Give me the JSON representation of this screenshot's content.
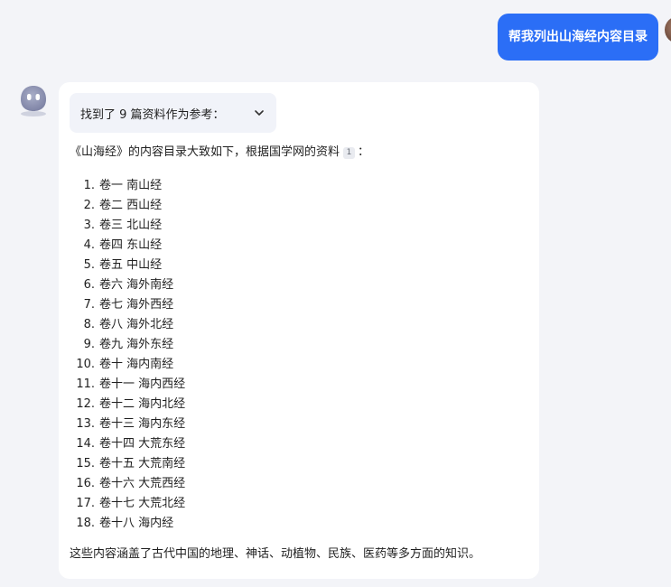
{
  "user_message": {
    "text": "帮我列出山海经内容目录"
  },
  "assistant": {
    "sources_label": "找到了 9 篇资料作为参考：",
    "intro_before": "《山海经》的内容目录大致如下，根据国学网的资料",
    "citation": "1",
    "intro_after": "：",
    "toc": [
      {
        "num": "1.",
        "label": "卷一 南山经"
      },
      {
        "num": "2.",
        "label": "卷二 西山经"
      },
      {
        "num": "3.",
        "label": "卷三 北山经"
      },
      {
        "num": "4.",
        "label": "卷四 东山经"
      },
      {
        "num": "5.",
        "label": "卷五 中山经"
      },
      {
        "num": "6.",
        "label": "卷六 海外南经"
      },
      {
        "num": "7.",
        "label": "卷七 海外西经"
      },
      {
        "num": "8.",
        "label": "卷八 海外北经"
      },
      {
        "num": "9.",
        "label": "卷九 海外东经"
      },
      {
        "num": "10.",
        "label": "卷十 海内南经"
      },
      {
        "num": "11.",
        "label": "卷十一 海内西经"
      },
      {
        "num": "12.",
        "label": "卷十二 海内北经"
      },
      {
        "num": "13.",
        "label": "卷十三 海内东经"
      },
      {
        "num": "14.",
        "label": "卷十四 大荒东经"
      },
      {
        "num": "15.",
        "label": "卷十五 大荒南经"
      },
      {
        "num": "16.",
        "label": "卷十六 大荒西经"
      },
      {
        "num": "17.",
        "label": "卷十七 大荒北经"
      },
      {
        "num": "18.",
        "label": "卷十八 海内经"
      }
    ],
    "summary": "这些内容涵盖了古代中国的地理、神话、动植物、民族、医药等多方面的知识。"
  },
  "colors": {
    "user_bubble": "#2b6ef6",
    "background": "#f3f4f8",
    "card": "#ffffff",
    "bot_avatar": "#8a8fb0"
  },
  "icons": {
    "bot_avatar": "bot-face-icon",
    "user_avatar": "user-photo",
    "expand": "chevron-down-icon"
  }
}
